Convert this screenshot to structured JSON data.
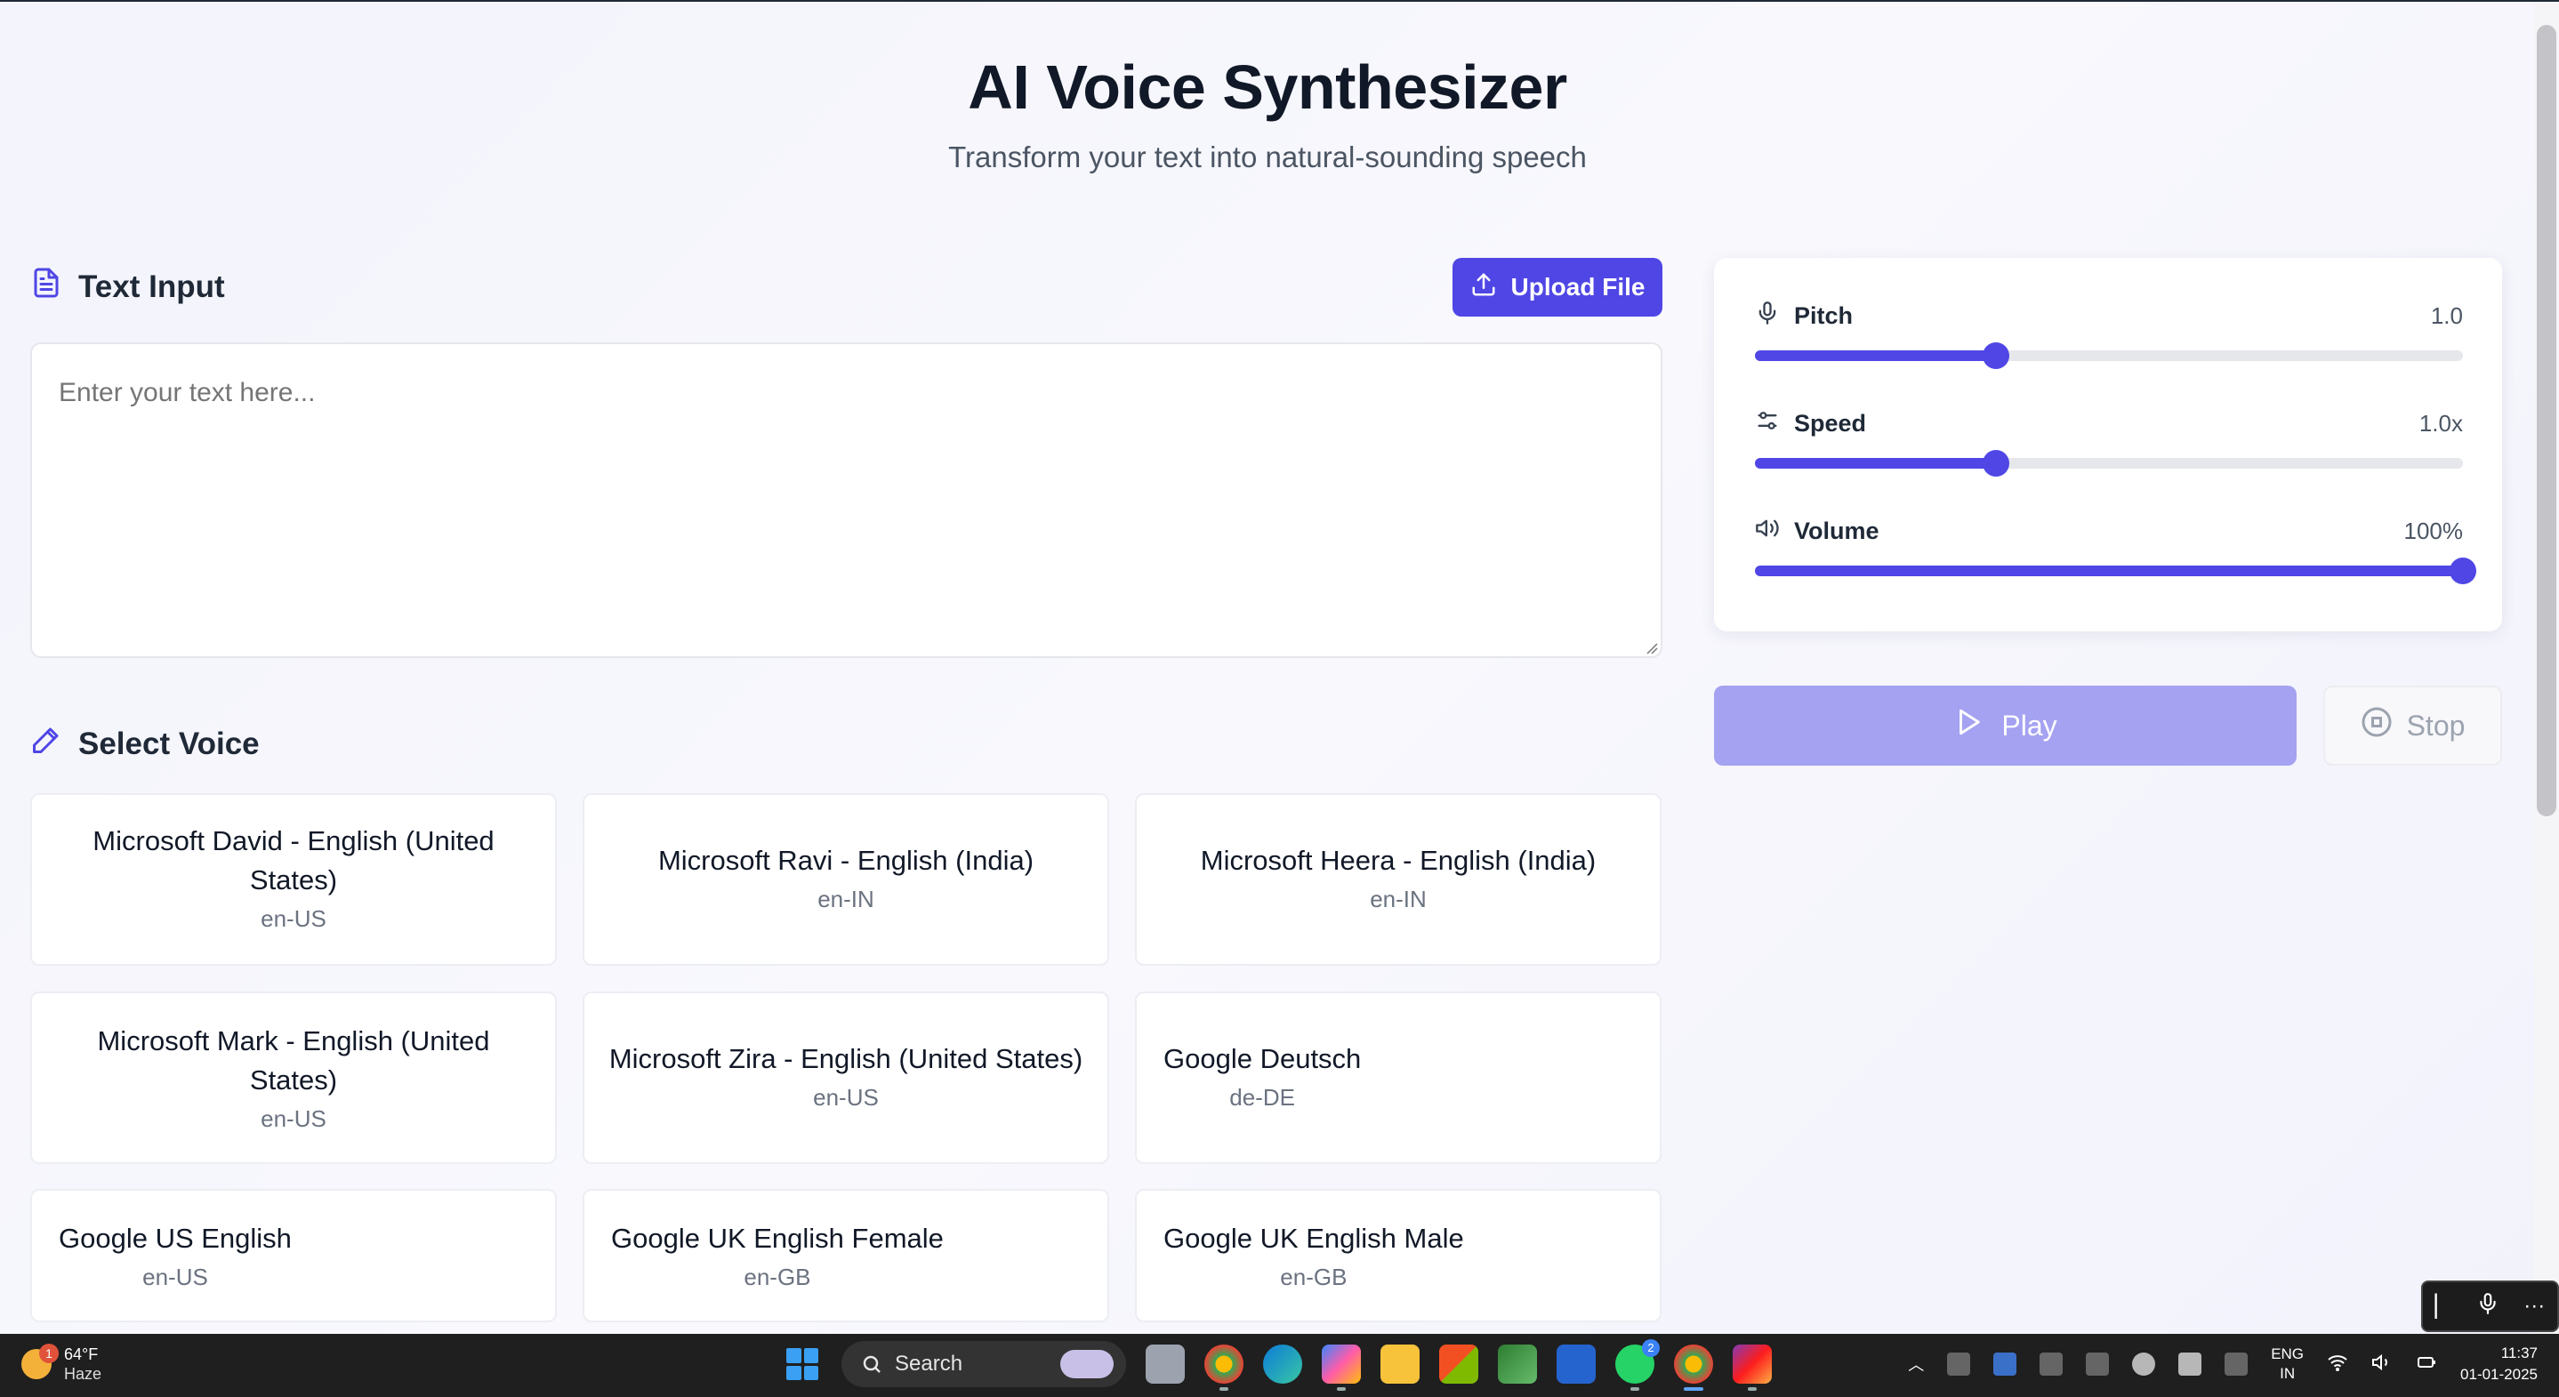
{
  "header": {
    "title": "AI Voice Synthesizer",
    "subtitle": "Transform your text into natural-sounding speech"
  },
  "text_input": {
    "heading": "Text Input",
    "upload_label": "Upload File",
    "placeholder": "Enter your text here..."
  },
  "voices": {
    "heading": "Select Voice",
    "items": [
      {
        "name": "Microsoft David - English (United States)",
        "lang": "en-US"
      },
      {
        "name": "Microsoft Ravi - English (India)",
        "lang": "en-IN"
      },
      {
        "name": "Microsoft Heera - English (India)",
        "lang": "en-IN"
      },
      {
        "name": "Microsoft Mark - English (United States)",
        "lang": "en-US"
      },
      {
        "name": "Microsoft Zira - English (United States)",
        "lang": "en-US"
      },
      {
        "name": "Google Deutsch",
        "lang": "de-DE"
      },
      {
        "name": "Google US English",
        "lang": "en-US"
      },
      {
        "name": "Google UK English Female",
        "lang": "en-GB"
      },
      {
        "name": "Google UK English Male",
        "lang": "en-GB"
      }
    ]
  },
  "controls": {
    "pitch": {
      "label": "Pitch",
      "value": "1.0",
      "fill": 0.34
    },
    "speed": {
      "label": "Speed",
      "value": "1.0x",
      "fill": 0.34
    },
    "volume": {
      "label": "Volume",
      "value": "100%",
      "fill": 1.0
    },
    "accent_color": "#4f46e5"
  },
  "actions": {
    "play_label": "Play",
    "stop_label": "Stop"
  },
  "taskbar": {
    "weather_badge": "1",
    "temperature": "64°F",
    "condition": "Haze",
    "search_label": "Search",
    "whatsapp_count": "2",
    "lang_top": "ENG",
    "lang_bottom": "IN",
    "time": "11:37",
    "date": "01-01-2025"
  }
}
